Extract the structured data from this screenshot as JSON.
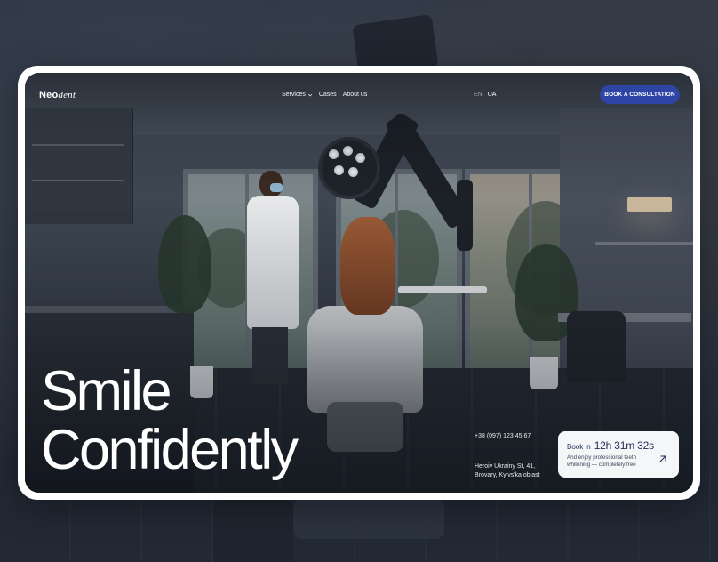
{
  "brand": {
    "name_bold": "Neo",
    "name_italic": "dent"
  },
  "nav": {
    "items": [
      {
        "label": "Services",
        "has_dropdown": true
      },
      {
        "label": "Cases"
      },
      {
        "label": "About us"
      }
    ]
  },
  "languages": [
    {
      "label": "EN",
      "active": false
    },
    {
      "label": "UA",
      "active": true
    }
  ],
  "cta": {
    "label": "BOOK A CONSULTATION",
    "color": "#2f45a6"
  },
  "hero": {
    "headline_line1": "Smile",
    "headline_line2": "Confidently"
  },
  "contact": {
    "phone": "+38 (097) 123 45 67",
    "address_line1": "Heroiv Ukrainy St, 41,",
    "address_line2": "Brovary, Kyivs'ka oblast"
  },
  "booking_card": {
    "label": "Book in",
    "countdown": "12h 31m 32s",
    "description": "And enjoy professional teeth whitening — completely free",
    "icon": "arrow-up-right-icon",
    "text_color": "#1f2a5a"
  }
}
